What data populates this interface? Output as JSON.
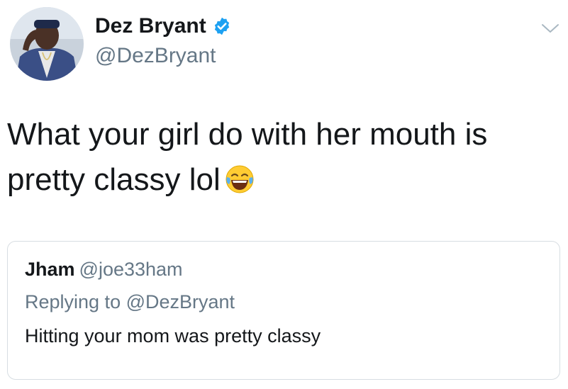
{
  "author": {
    "display_name": "Dez Bryant",
    "handle": "@DezBryant",
    "verified": true,
    "avatar_icon": "profile-photo"
  },
  "tweet": {
    "text": "What your girl do with her mouth is pretty classy lol",
    "emoji_icon": "face-with-tears-of-joy"
  },
  "quoted_tweet": {
    "display_name": "Jham",
    "handle": "@joe33ham",
    "reply_context": "Replying to @DezBryant",
    "text": "Hitting your mom was pretty classy"
  },
  "colors": {
    "text": "#14171a",
    "secondary": "#657786",
    "verified": "#1da1f2",
    "border": "#d7dde2"
  }
}
